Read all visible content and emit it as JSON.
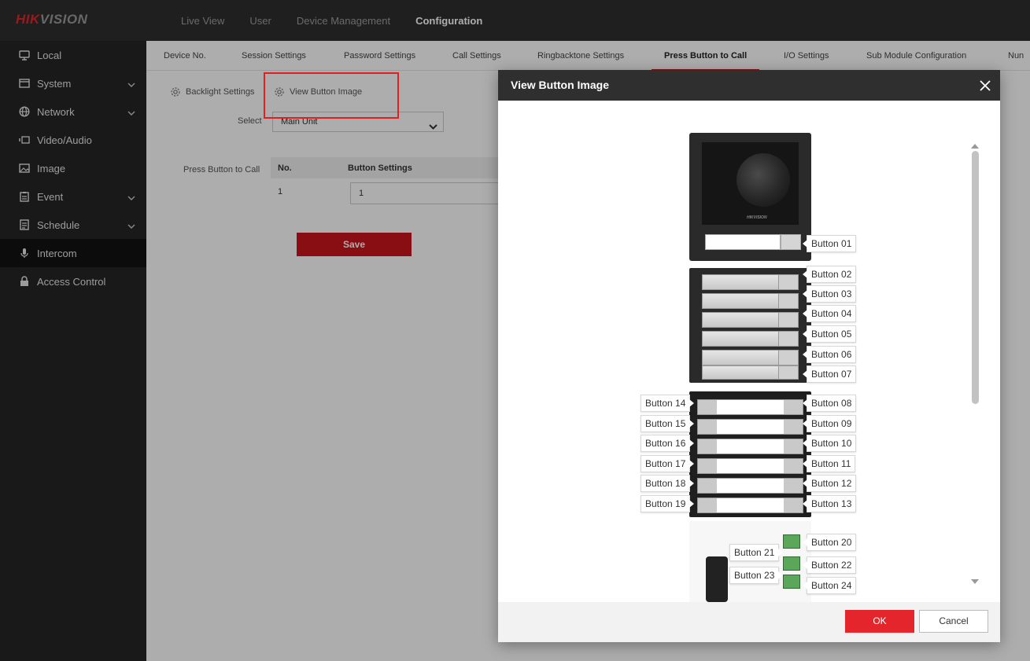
{
  "brand": {
    "hik": "HIK",
    "vision": "VISION"
  },
  "top_nav": [
    "Live View",
    "User",
    "Device Management",
    "Configuration"
  ],
  "sidebar": {
    "items": [
      {
        "label": "Local",
        "icon": "monitor-icon"
      },
      {
        "label": "System",
        "icon": "system-icon"
      },
      {
        "label": "Network",
        "icon": "globe-icon"
      },
      {
        "label": "Video/Audio",
        "icon": "camera-icon"
      },
      {
        "label": "Image",
        "icon": "image-icon"
      },
      {
        "label": "Event",
        "icon": "clipboard-icon"
      },
      {
        "label": "Schedule",
        "icon": "calendar-icon"
      },
      {
        "label": "Intercom",
        "icon": "microphone-icon"
      },
      {
        "label": "Access Control",
        "icon": "lock-icon"
      }
    ]
  },
  "sub_tabs": [
    "Device No.",
    "Session Settings",
    "Password Settings",
    "Call Settings",
    "Ringbacktone Settings",
    "Press Button to Call",
    "I/O Settings",
    "Sub Module Configuration",
    "Nun"
  ],
  "page": {
    "backlight_label": "Backlight Settings",
    "view_image_label": "View Button Image",
    "select_label": "Select",
    "select_value": "Main Unit",
    "press_button_label": "Press Button to Call",
    "table_headers": {
      "no": "No.",
      "settings": "Button Settings"
    },
    "row": {
      "no": "1",
      "value": "1"
    },
    "save_label": "Save"
  },
  "modal": {
    "title": "View Button Image",
    "ok_label": "OK",
    "cancel_label": "Cancel",
    "device_logo": "HIKVISION",
    "buttons": [
      "Button 01",
      "Button 02",
      "Button 03",
      "Button 04",
      "Button 05",
      "Button 06",
      "Button 07",
      "Button 08",
      "Button 09",
      "Button 10",
      "Button 11",
      "Button 12",
      "Button 13",
      "Button 14",
      "Button 15",
      "Button 16",
      "Button 17",
      "Button 18",
      "Button 19",
      "Button 20",
      "Button 21",
      "Button 22",
      "Button 23",
      "Button 24"
    ]
  },
  "colors": {
    "accent": "#c9151e",
    "topbar": "#2f2f2f",
    "sidebar": "#252525",
    "ok_button": "#e4252c"
  }
}
